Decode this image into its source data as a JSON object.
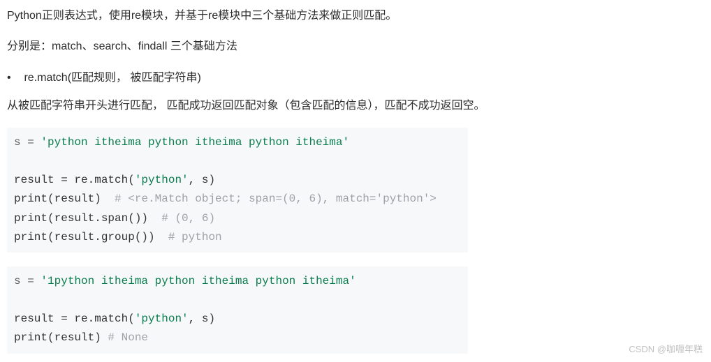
{
  "paragraphs": {
    "p1": "Python正则表达式，使用re模块，并基于re模块中三个基础方法来做正则匹配。",
    "p2": "分别是：match、search、findall 三个基础方法",
    "bullet_mark": "•",
    "bullet_text": "re.match(匹配规则， 被匹配字符串)",
    "p3": "从被匹配字符串开头进行匹配， 匹配成功返回匹配对象（包含匹配的信息），匹配不成功返回空。"
  },
  "code1": {
    "l1_a": "s = ",
    "l1_str": "'python itheima python itheima python itheima'",
    "l2": "",
    "l3_a": "result = re.match(",
    "l3_str": "'python'",
    "l3_b": ", s)",
    "l4_a": "print(result)  ",
    "l4_c": "# <re.Match object; span=(0, 6), match='python'>",
    "l5_a": "print(result.span())  ",
    "l5_c": "# (0, 6)",
    "l6_a": "print(result.group())  ",
    "l6_c": "# python"
  },
  "code2": {
    "l1_a": "s = ",
    "l1_str": "'1python itheima python itheima python itheima'",
    "l2": "",
    "l3_a": "result = re.match(",
    "l3_str": "'python'",
    "l3_b": ", s)",
    "l4_a": "print(result) ",
    "l4_c": "# None"
  },
  "watermark": "CSDN @咖喱年糕"
}
